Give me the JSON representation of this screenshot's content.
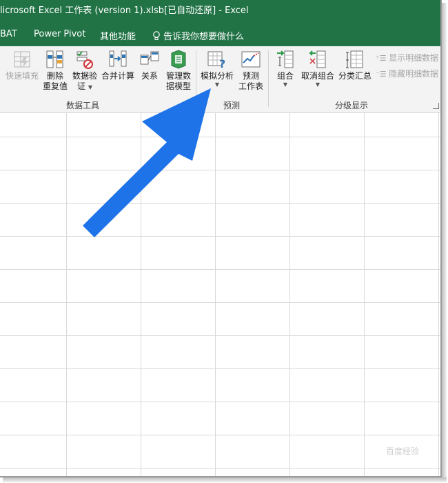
{
  "window": {
    "title": "licrosoft Excel 工作表 (version 1).xlsb[已自动还原]  -  Excel"
  },
  "tabs": [
    {
      "label": "BAT"
    },
    {
      "label": "Power Pivot"
    },
    {
      "label": "其他功能"
    }
  ],
  "tell_me": {
    "text": "告诉我你想要做什么",
    "icon": "lightbulb-icon"
  },
  "ribbon": {
    "data_tools": {
      "group_label": "数据工具",
      "flash_fill": {
        "label": "快速填充",
        "icon": "flash-fill-icon"
      },
      "remove_duplicates": {
        "line1": "删除",
        "line2": "重复值",
        "icon": "remove-duplicates-icon"
      },
      "data_validation": {
        "line1": "数据验",
        "line2": "证",
        "icon": "data-validation-icon"
      },
      "consolidate": {
        "label": "合并计算",
        "icon": "consolidate-icon"
      },
      "relationships": {
        "label": "关系",
        "icon": "relationships-icon"
      },
      "data_model": {
        "line1": "管理数",
        "line2": "据模型",
        "icon": "data-model-icon"
      }
    },
    "forecast": {
      "group_label": "预测",
      "what_if": {
        "label": "模拟分析",
        "icon": "what-if-analysis-icon"
      },
      "forecast_sheet": {
        "line1": "预测",
        "line2": "工作表",
        "icon": "forecast-sheet-icon"
      }
    },
    "outline": {
      "group_label": "分级显示",
      "group": {
        "label": "组合",
        "icon": "group-icon"
      },
      "ungroup": {
        "label": "取消组合",
        "icon": "ungroup-icon"
      },
      "subtotal": {
        "label": "分类汇总",
        "icon": "subtotal-icon"
      },
      "show_detail": {
        "label": "显示明细数据"
      },
      "hide_detail": {
        "label": "隐藏明细数据"
      }
    }
  },
  "colors": {
    "excel_green": "#217346",
    "arrow_blue": "#1e73e8"
  },
  "watermark": {
    "text": "百度经验"
  }
}
